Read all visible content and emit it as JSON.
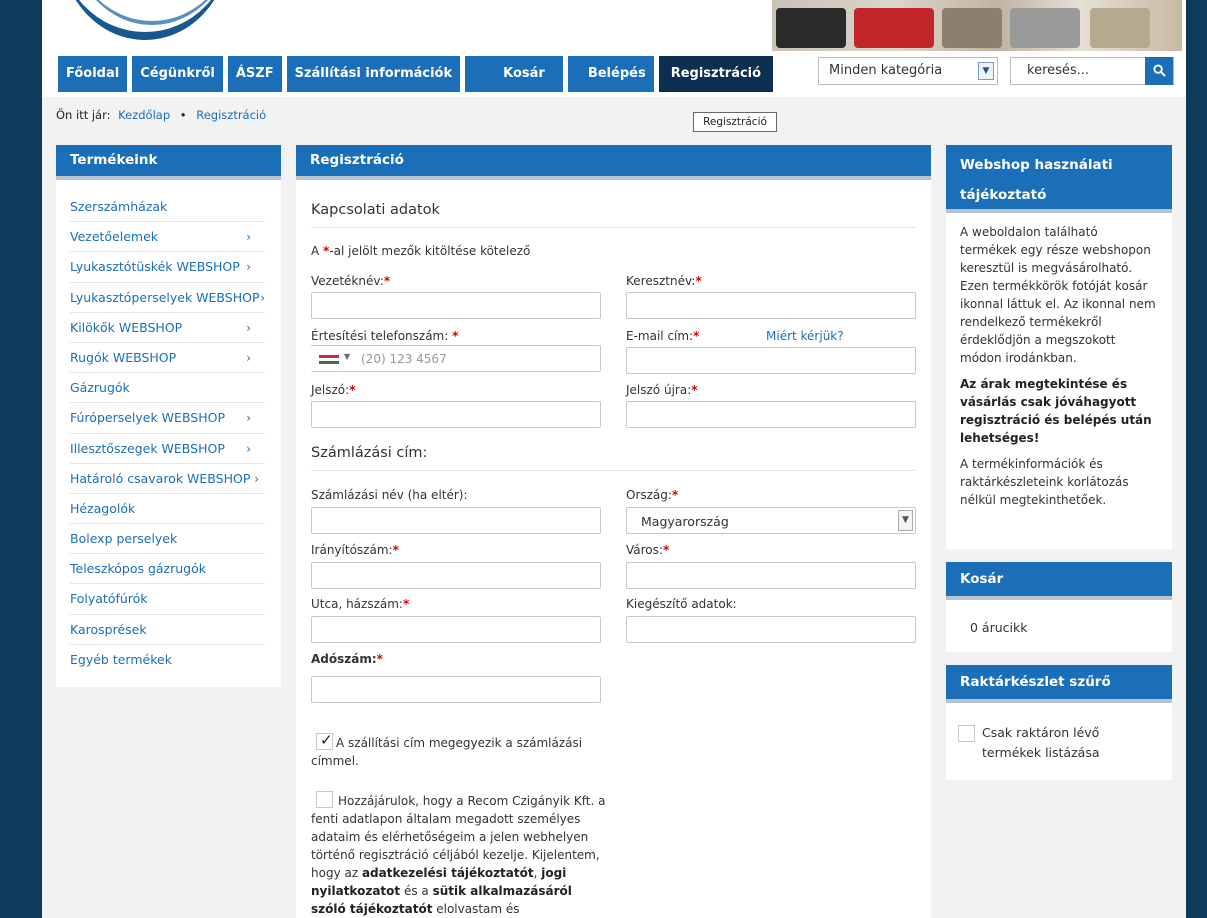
{
  "nav": {
    "items": [
      "Főoldal",
      "Cégünkről",
      "ÁSZF",
      "Szállítási információk",
      "Kosár",
      "Belépés",
      "Regisztráció"
    ]
  },
  "search": {
    "category": "Minden kategória",
    "placeholder": "keresés..."
  },
  "breadcrumb": {
    "prefix": "Ön itt jár:",
    "home": "Kezdőlap",
    "separator": "•",
    "current": "Regisztráció"
  },
  "tooltip": "Regisztráció",
  "sidebar": {
    "title": "Termékeink",
    "items": [
      {
        "label": "Szerszámházak",
        "chevron": ""
      },
      {
        "label": "Vezetőelemek",
        "chevron": "›"
      },
      {
        "label": "Lyukasztótüskék WEBSHOP",
        "chevron": "›"
      },
      {
        "label": "Lyukasztóperselyek WEBSHOP",
        "chevron": "›"
      },
      {
        "label": "Kilökők WEBSHOP",
        "chevron": "›"
      },
      {
        "label": "Rugók WEBSHOP",
        "chevron": "›"
      },
      {
        "label": "Gázrugók",
        "chevron": ""
      },
      {
        "label": "Fúróperselyek WEBSHOP",
        "chevron": "›"
      },
      {
        "label": "Illesztőszegek WEBSHOP",
        "chevron": "›"
      },
      {
        "label": "Határoló csavarok WEBSHOP",
        "chevron": "›"
      },
      {
        "label": "Hézagolók",
        "chevron": ""
      },
      {
        "label": "Bolexp perselyek",
        "chevron": ""
      },
      {
        "label": "Teleszkópos gázrugók",
        "chevron": ""
      },
      {
        "label": "Folyatófúrók",
        "chevron": ""
      },
      {
        "label": "Karosprések",
        "chevron": ""
      },
      {
        "label": "Egyéb termékek",
        "chevron": ""
      }
    ]
  },
  "form": {
    "title": "Regisztráció",
    "contact_title": "Kapcsolati adatok",
    "required_note_pre": "A ",
    "required_star": "*",
    "required_note_post": "-al jelölt mezők kitöltése kötelező",
    "lastname": "Vezetéknév:",
    "firstname": "Keresztnév:",
    "phone": "Értesítési telefonszám: ",
    "phone_why": "Miért kérjük?",
    "phone_placeholder": "(20) 123 4567",
    "email": "E-mail cím:",
    "password": "Jelszó:",
    "password_again": "Jelszó újra:",
    "billing_title": "Számlázási cím:",
    "billing_name": "Számlázási név (ha eltér):",
    "country": "Ország:",
    "country_value": "Magyarország",
    "zip": "Irányítószám:",
    "city": "Város:",
    "street": "Utca, házszám:",
    "extra": "Kiegészítő adatok:",
    "tax": "Adószám:",
    "same_address_1": "A szállítási cím megegyezik a számlázási",
    "same_address_2": "címmel.",
    "consent": {
      "l1": "Hozzájárulok, hogy a Recom Czigányik Kft. a",
      "l2": "fenti adatlapon általam megadott személyes",
      "l3": "adataim és elérhetőségeim a jelen webhelyen",
      "l4": "történő regisztráció céljából kezelje. Kijelentem,",
      "l5_pre": "hogy az ",
      "l5_b1": "adatkezelési tájékoztatót",
      "l5_mid": ", ",
      "l5_b2": "jogi",
      "l6_b": "nyilatkozatot",
      "l6_mid": " és a ",
      "l6_b2": "sütik alkalmazásáról",
      "l7_b": "szóló tájékoztatót",
      "l7_post": " elolvastam és"
    }
  },
  "info_panel": {
    "title_1": "Webshop használati",
    "title_2": "tájékoztató",
    "p1": "A weboldalon található termékek egy része webshopon keresztül is megvásárolható. Ezen termékkörök fotóját kosár ikonnal láttuk el. Az ikonnal nem rendelkező termékekről érdeklődjön a megszokott módon irodánkban.",
    "p2": "Az árak megtekintése és vásárlás csak jóváhagyott regisztráció és belépés után lehetséges!",
    "p3": "A termékinformációk és raktárkészleteink korlátozás nélkül megtekinthetőek."
  },
  "cart_panel": {
    "title": "Kosár",
    "content": "0 árucikk"
  },
  "stock_panel": {
    "title": "Raktárkészlet szűrő",
    "label": "Csak raktáron lévő termékek listázása"
  },
  "colors": {
    "primary": "#1b6fb8",
    "nav_active": "#0d2f4f",
    "background": "#0e3a5c",
    "required": "#d50000"
  }
}
